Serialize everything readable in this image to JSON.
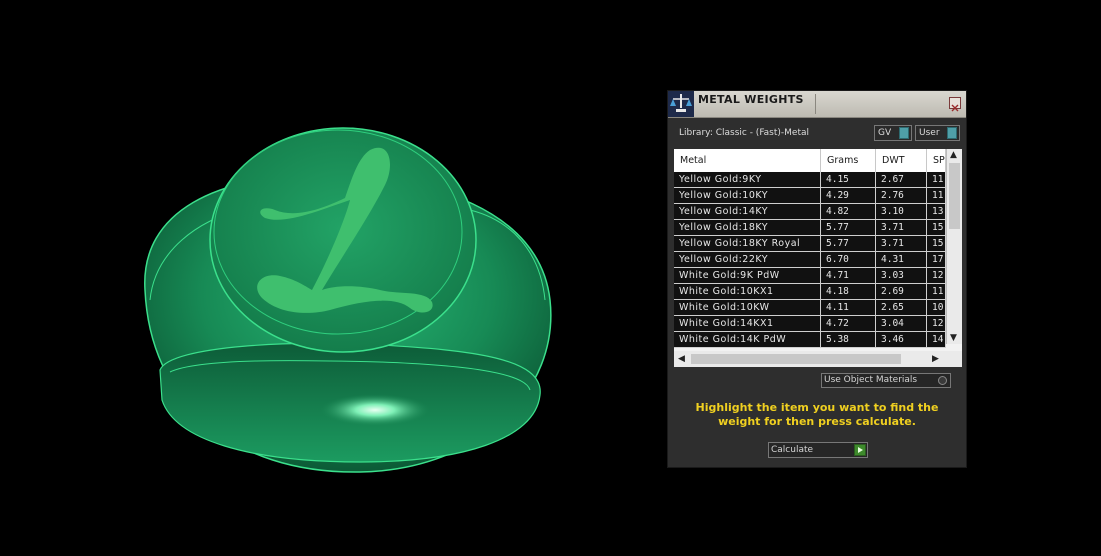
{
  "panel": {
    "title": "METAL WEIGHTS",
    "library_label": "Library: Classic - (Fast)-Metal",
    "toggle_gv": "GV",
    "toggle_user": "User",
    "columns": [
      "Metal",
      "Grams",
      "DWT",
      "SP"
    ],
    "rows": [
      {
        "metal": "Yellow Gold:9KY",
        "grams": "4.15",
        "dwt": "2.67",
        "sp": "11"
      },
      {
        "metal": "Yellow Gold:10KY",
        "grams": "4.29",
        "dwt": "2.76",
        "sp": "11"
      },
      {
        "metal": "Yellow Gold:14KY",
        "grams": "4.82",
        "dwt": "3.10",
        "sp": "13"
      },
      {
        "metal": "Yellow Gold:18KY",
        "grams": "5.77",
        "dwt": "3.71",
        "sp": "15"
      },
      {
        "metal": "Yellow Gold:18KY Royal",
        "grams": "5.77",
        "dwt": "3.71",
        "sp": "15"
      },
      {
        "metal": "Yellow Gold:22KY",
        "grams": "6.70",
        "dwt": "4.31",
        "sp": "17"
      },
      {
        "metal": "White Gold:9K PdW",
        "grams": "4.71",
        "dwt": "3.03",
        "sp": "12"
      },
      {
        "metal": "White Gold:10KX1",
        "grams": "4.18",
        "dwt": "2.69",
        "sp": "11"
      },
      {
        "metal": "White Gold:10KW",
        "grams": "4.11",
        "dwt": "2.65",
        "sp": "10"
      },
      {
        "metal": "White Gold:14KX1",
        "grams": "4.72",
        "dwt": "3.04",
        "sp": "12"
      },
      {
        "metal": "White Gold:14K PdW",
        "grams": "5.38",
        "dwt": "3.46",
        "sp": "14"
      }
    ],
    "use_object_materials": "Use Object Materials",
    "hint": "Highlight the item you want to find the weight for then press calculate.",
    "calculate_label": "Calculate"
  },
  "viewport": {
    "object": "signet ring",
    "engraving_letter": "L",
    "ring_color": "#1e9b63",
    "engraving_color": "#3dbb6c"
  }
}
